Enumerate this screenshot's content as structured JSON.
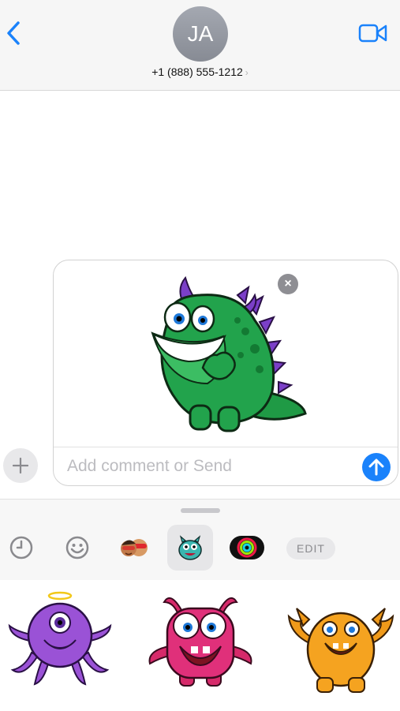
{
  "header": {
    "avatar_initials": "JA",
    "contact_number": "+1 (888) 555-1212",
    "accent_color": "#1a82fb"
  },
  "composer": {
    "sticker_name": "green-dinosaur-monster-sticker",
    "comment_placeholder": "Add comment or Send"
  },
  "drawer": {
    "tabs": [
      "recents-icon",
      "emoji-icon",
      "memoji-icon",
      "monster-pack-icon",
      "activity-rings-icon"
    ],
    "edit_label": "EDIT",
    "stickers": [
      "purple-octopus-monster-sticker",
      "pink-monster-sticker",
      "orange-monster-sticker"
    ]
  }
}
